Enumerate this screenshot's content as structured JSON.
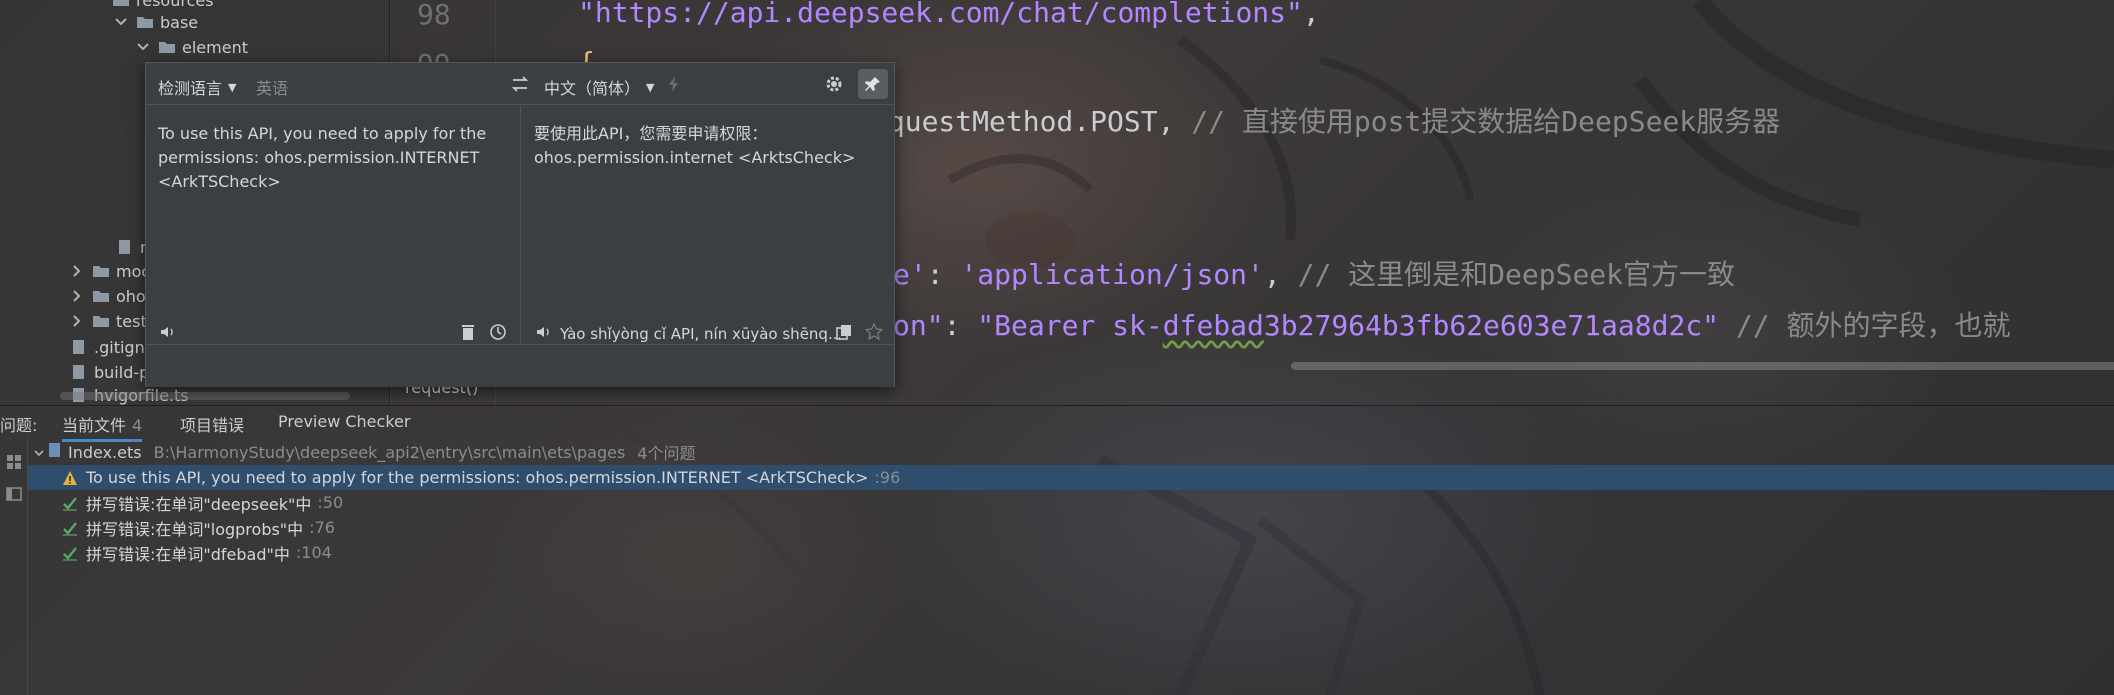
{
  "tree": {
    "items": [
      {
        "label": "resources",
        "depth": 0
      },
      {
        "label": "base",
        "depth": 1
      },
      {
        "label": "element",
        "depth": 2
      },
      {
        "label": "m",
        "depth": 1
      },
      {
        "label": "moc",
        "depth": 0
      },
      {
        "label": "oho",
        "depth": 0
      },
      {
        "label": "test",
        "depth": 0
      },
      {
        "label": ".gitign",
        "depth": 0
      },
      {
        "label": "build-p",
        "depth": 0
      },
      {
        "label": "hvigorfile.ts",
        "depth": 0
      }
    ]
  },
  "editor": {
    "line_numbers": [
      "98",
      "99"
    ],
    "line_url": "\"https://api.deepseek.com/chat/completions\"",
    "line_comma": ",",
    "line_brace": "{",
    "line_method_code": "equestMethod.POST",
    "line_method_comma": ",",
    "line_method_comment": "// 直接使用post提交数据给DeepSeek服务器",
    "line_ct_key_tail": "e'",
    "line_ct_colon": ": ",
    "line_ct_value": "'application/json'",
    "line_ct_comment": "// 这里倒是和DeepSeek官方一致",
    "line_auth_key_tail": "on\"",
    "line_auth_colon": ": ",
    "line_auth_value_prefix": "\"Bearer sk-",
    "line_auth_value_typo": "dfebad",
    "line_auth_value_suffix": "3b27964b3fb62e603e71aa8d2c\"",
    "line_auth_comment": "// 额外的字段，也就",
    "breadcrumb": "request()"
  },
  "translator": {
    "source_lang": "检测语言",
    "target_lang_hint": "英语",
    "target_lang": "中文（简体）",
    "source_text": "To use this API, you need to apply for the permissions: ohos.permission.INTERNET <ArkTSCheck>",
    "translated_text": "要使用此API，您需要申请权限：ohos.permission.internet <ArktsCheck>",
    "pinyin": "Yào shǐyòng cǐ API, nín xūyào shēnq..."
  },
  "problems": {
    "label": "问题:",
    "tabs": [
      {
        "label": "当前文件",
        "count": "4"
      },
      {
        "label": "项目错误",
        "count": ""
      },
      {
        "label": "Preview Checker",
        "count": ""
      }
    ],
    "file": {
      "name": "Index.ets",
      "path": "B:\\HarmonyStudy\\deepseek_api2\\entry\\src\\main\\ets\\pages",
      "count": "4个问题"
    },
    "rows": [
      {
        "severity": "warning",
        "text": "To use this API, you need to apply for the permissions: ohos.permission.INTERNET <ArkTSCheck>",
        "line": ":96"
      },
      {
        "severity": "typo",
        "text": "拼写错误:在单词\"deepseek\"中",
        "line": ":50"
      },
      {
        "severity": "typo",
        "text": "拼写错误:在单词\"logprobs\"中",
        "line": ":76"
      },
      {
        "severity": "typo",
        "text": "拼写错误:在单词\"dfebad\"中",
        "line": ":104"
      }
    ]
  },
  "colors": {
    "string": "#b287ff",
    "comment": "#8a8a8a",
    "selection": "#2f4d6c",
    "warning": "#e2b53a",
    "typo": "#59a869",
    "accent": "#4a88c7"
  }
}
